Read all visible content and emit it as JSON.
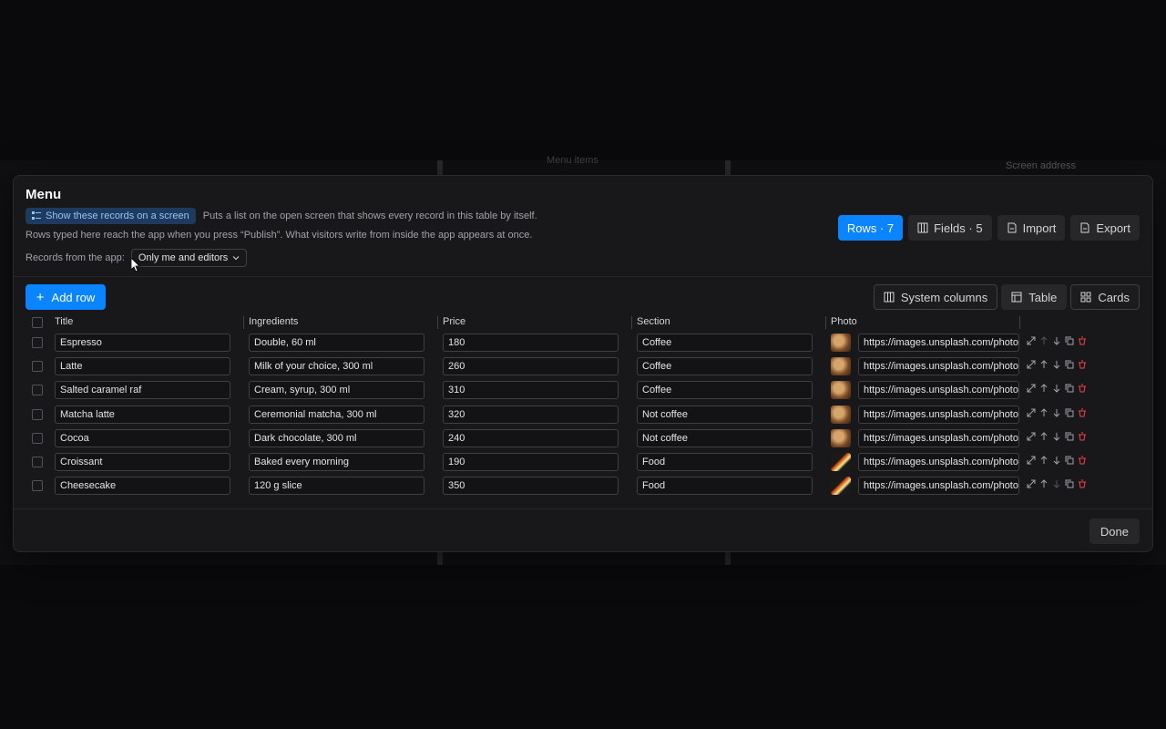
{
  "background": {
    "screen_address": "Screen address",
    "header_fragment": "Menu items"
  },
  "dialog": {
    "title": "Menu",
    "show_records_button": "Show these records on a screen",
    "show_records_note": "Puts a list on the open screen that shows every record in this table by itself.",
    "publish_note": "Rows typed here reach the app when you press “Publish”. What visitors write from inside the app appears at once.",
    "records_label": "Records from the app:",
    "records_value": "Only me and editors",
    "tabs": [
      {
        "label": "Rows · 7",
        "icon": "rows-icon",
        "active": true
      },
      {
        "label": "Fields · 5",
        "icon": "columns-icon",
        "active": false
      },
      {
        "label": "Import",
        "icon": "file-import-icon",
        "active": false
      },
      {
        "label": "Export",
        "icon": "file-export-icon",
        "active": false
      }
    ],
    "add_row": "Add row",
    "views": [
      {
        "label": "System columns",
        "icon": "columns-icon"
      },
      {
        "label": "Table",
        "icon": "table-icon"
      },
      {
        "label": "Cards",
        "icon": "grid-icon"
      }
    ],
    "columns": [
      "Title",
      "Ingredients",
      "Price",
      "Section",
      "Photo"
    ],
    "rows": [
      {
        "title": "Espresso",
        "ingredients": "Double, 60 ml",
        "price": "180",
        "section": "Coffee",
        "photo_url": "https://images.unsplash.com/photo",
        "thumb": "coffee"
      },
      {
        "title": "Latte",
        "ingredients": "Milk of your choice, 300 ml",
        "price": "260",
        "section": "Coffee",
        "photo_url": "https://images.unsplash.com/photo",
        "thumb": "coffee"
      },
      {
        "title": "Salted caramel raf",
        "ingredients": "Cream, syrup, 300 ml",
        "price": "310",
        "section": "Coffee",
        "photo_url": "https://images.unsplash.com/photo",
        "thumb": "coffee"
      },
      {
        "title": "Matcha latte",
        "ingredients": "Ceremonial matcha, 300 ml",
        "price": "320",
        "section": "Not coffee",
        "photo_url": "https://images.unsplash.com/photo",
        "thumb": "coffee"
      },
      {
        "title": "Cocoa",
        "ingredients": "Dark chocolate, 300 ml",
        "price": "240",
        "section": "Not coffee",
        "photo_url": "https://images.unsplash.com/photo",
        "thumb": "coffee"
      },
      {
        "title": "Croissant",
        "ingredients": "Baked every morning",
        "price": "190",
        "section": "Food",
        "photo_url": "https://images.unsplash.com/photo",
        "thumb": "food"
      },
      {
        "title": "Cheesecake",
        "ingredients": "120 g slice",
        "price": "350",
        "section": "Food",
        "photo_url": "https://images.unsplash.com/photo",
        "thumb": "food"
      }
    ],
    "done": "Done",
    "accent": "#0a84ff",
    "delete_color": "#ef4444"
  }
}
